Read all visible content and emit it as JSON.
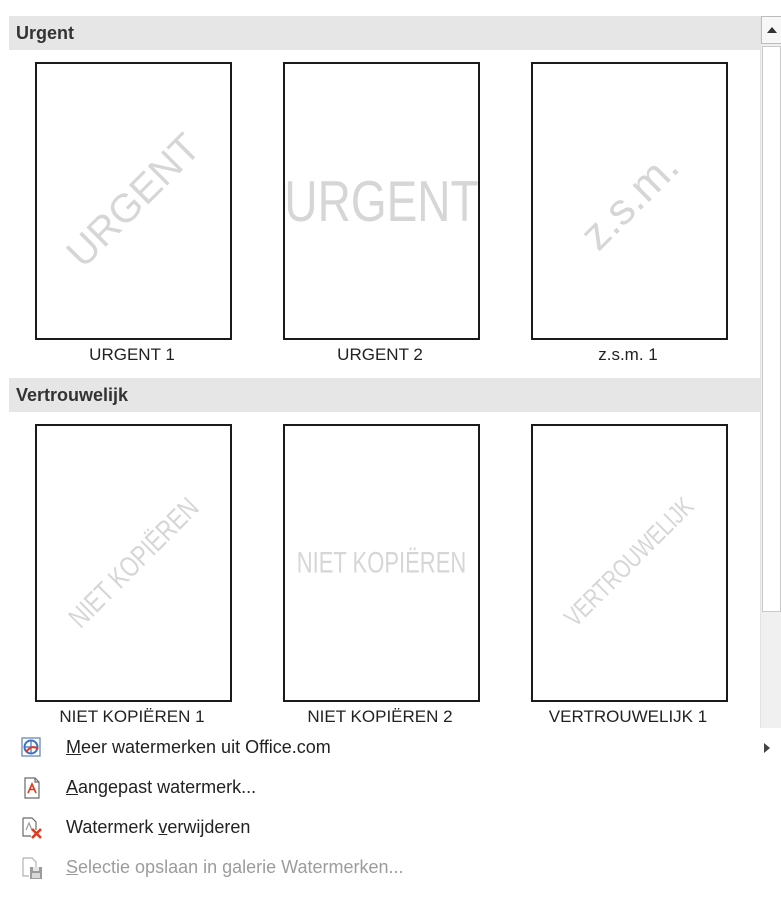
{
  "gallery": {
    "groups": [
      {
        "title": "Urgent",
        "items": [
          {
            "caption": "URGENT 1",
            "watermark": "URGENT",
            "orientation": "diagonal"
          },
          {
            "caption": "URGENT 2",
            "watermark": "URGENT",
            "orientation": "horizontal"
          },
          {
            "caption": "z.s.m. 1",
            "watermark": "z.s.m.",
            "orientation": "diagonal"
          }
        ]
      },
      {
        "title": "Vertrouwelijk",
        "items": [
          {
            "caption": "NIET KOPIËREN 1",
            "watermark": "NIET KOPIËREN",
            "orientation": "diagonal"
          },
          {
            "caption": "NIET KOPIËREN 2",
            "watermark": "NIET KOPIËREN",
            "orientation": "horizontal"
          },
          {
            "caption": "VERTROUWELIJK 1",
            "watermark": "VERTROUWELIJK",
            "orientation": "diagonal"
          }
        ]
      }
    ]
  },
  "menu": {
    "more": {
      "underline": "M",
      "rest": "eer watermerken uit Office.com",
      "icon": "office-globe-icon"
    },
    "custom": {
      "underline": "A",
      "rest": "angepast watermerk...",
      "icon": "custom-watermark-icon"
    },
    "remove": {
      "before": "Watermerk ",
      "underline": "v",
      "rest": "erwijderen",
      "icon": "remove-watermark-icon"
    },
    "save": {
      "underline": "S",
      "rest": "electie opslaan in galerie Watermerken...",
      "icon": "save-gallery-icon"
    }
  },
  "colors": {
    "header_bg": "#e6e6e6",
    "watermark": "#d6d6d6",
    "delete_red": "#e03a1f",
    "disabled_text": "#9c9c9c"
  }
}
